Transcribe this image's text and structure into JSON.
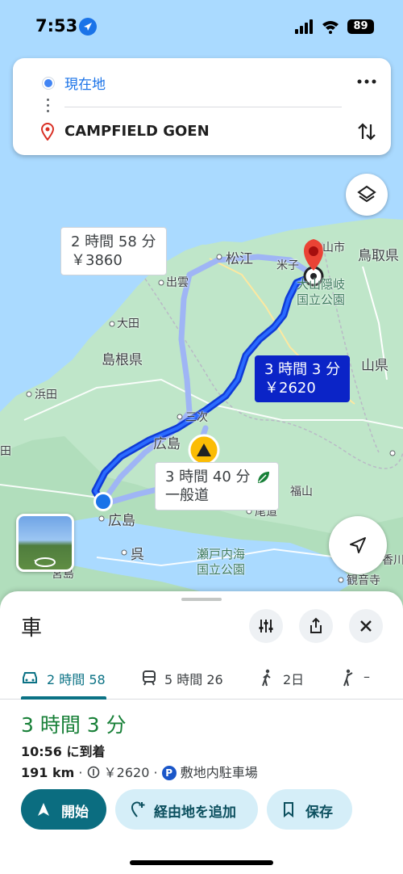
{
  "status_bar": {
    "time": "7:53",
    "battery": "89"
  },
  "search": {
    "origin": "現在地",
    "destination": "CAMPFIELD GOEN"
  },
  "map": {
    "places": {
      "matsue": "松江",
      "yonago": "米子",
      "tottori_pref": "鳥取県",
      "izumo": "出雲",
      "oda": "大田",
      "shimane_pref": "島根県",
      "hamada": "浜田",
      "miyoshi": "三次",
      "hiroshima_pref_partial": "広島",
      "hiroshima_city": "広島",
      "kure": "呉",
      "fukuyama_partial": "福山",
      "onomichi": "尾道",
      "kagawa_partial": "香川",
      "kanonji": "観音寺",
      "daisen_park_1": "大山隠岐",
      "daisen_park_2": "国立公園",
      "setonaikai_1": "瀬戸内海",
      "setonaikai_2": "国立公園",
      "okayama_partial": "山県",
      "yama_partial": "山市",
      "ta_partial": "田",
      "miyazaki_partial": "宮島"
    },
    "route_labels": {
      "alt1_time": "2 時間 58 分",
      "alt1_toll": "￥3860",
      "main_time": "3 時間 3 分",
      "main_toll": "￥2620",
      "alt2_time": "3 時間 40 分",
      "alt2_sub": "一般道"
    }
  },
  "sheet": {
    "mode_title": "車",
    "tabs": [
      {
        "label": "2 時間 58"
      },
      {
        "label": "5 時間 26"
      },
      {
        "label": "2日"
      },
      {
        "label": "–"
      }
    ],
    "duration": "3 時間 3 分",
    "arrival": "10:56 に到着",
    "distance": "191 km",
    "sep": "·",
    "toll": "￥2620",
    "parking": "敷地内駐車場",
    "actions": {
      "start": "開始",
      "add_stop": "経由地を追加",
      "save": "保存"
    }
  },
  "colors": {
    "accent_teal": "#0b6d80",
    "route_main": "#0b24c7",
    "route_alt": "#9fb5f5",
    "duration_green": "#188038",
    "link_blue": "#1a73e8"
  }
}
